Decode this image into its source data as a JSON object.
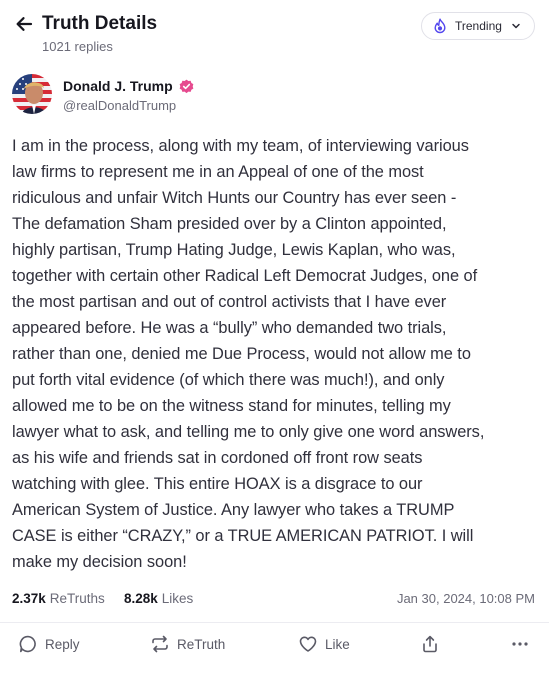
{
  "header": {
    "title": "Truth Details",
    "replies": "1021 replies",
    "trending_label": "Trending"
  },
  "author": {
    "name": "Donald J. Trump",
    "handle": "@realDonaldTrump"
  },
  "post": {
    "lines": [
      "I am in the process, along with my team, of interviewing various",
      "law firms to represent me in an Appeal of one of the most",
      "ridiculous and unfair Witch Hunts our Country has ever seen -",
      "The defamation Sham presided over by a Clinton appointed,",
      "highly partisan, Trump Hating Judge, Lewis Kaplan, who was,",
      "together with certain other Radical Left Democrat Judges, one of",
      "the most partisan and out of control activists that I have ever",
      "appeared before. He was a “bully” who demanded two trials,",
      "rather than one, denied me Due Process, would not allow me to",
      "put forth vital evidence (of which there was much!), and only",
      "allowed me to be on the witness stand for minutes, telling my",
      "lawyer what to ask, and telling me to only give one word answers,",
      "as his wife and friends sat in cordoned off front row seats",
      "watching with glee. This entire HOAX is a disgrace to our",
      "American System of Justice. Any lawyer who takes a TRUMP",
      "CASE is either “CRAZY,” or a TRUE AMERICAN PATRIOT. I will",
      "make my decision soon!"
    ]
  },
  "stats": {
    "retruths_count": "2.37k",
    "retruths_label": "ReTruths",
    "likes_count": "8.28k",
    "likes_label": "Likes",
    "date": "Jan 30, 2024, 10:08 PM"
  },
  "actions": {
    "reply": "Reply",
    "retruth": "ReTruth",
    "like": "Like"
  },
  "colors": {
    "verified": "#e64a8f",
    "trending_icon": "#5448ee",
    "text": "#30303c",
    "muted": "#6b6b78"
  },
  "icons": {
    "back": "arrow-left-icon",
    "trending": "flame-icon",
    "chevron": "chevron-down-icon",
    "verified": "verified-badge-icon",
    "reply": "speech-bubble-icon",
    "retruth": "retruth-arrows-icon",
    "like": "heart-icon",
    "share": "share-icon",
    "more": "more-dots-icon"
  }
}
